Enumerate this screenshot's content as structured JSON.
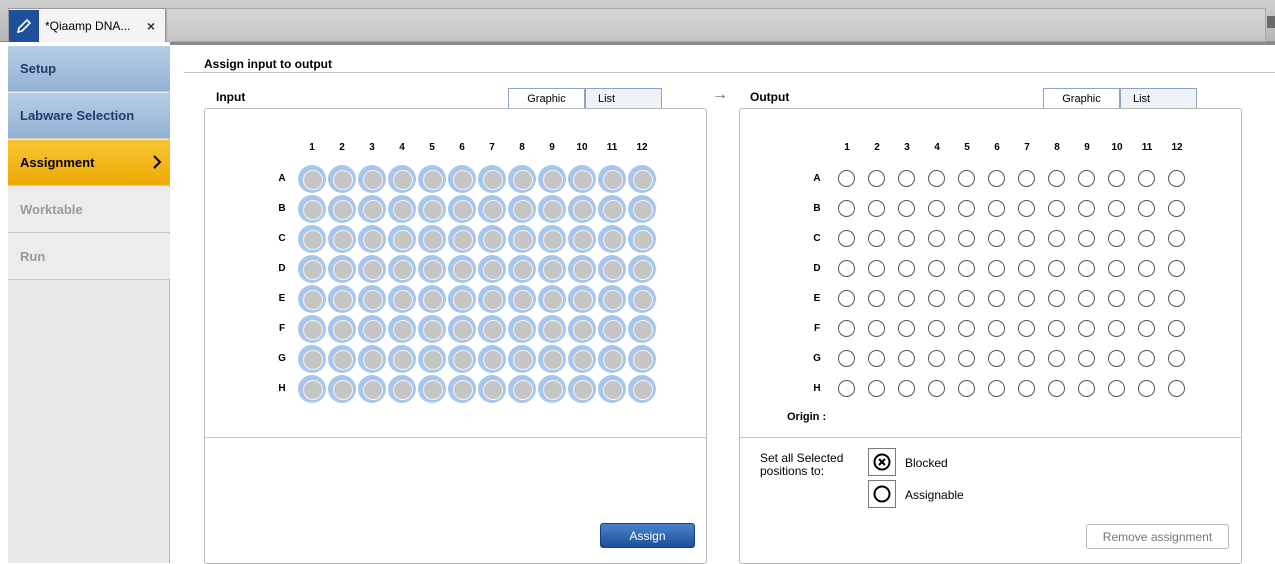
{
  "tab": {
    "title": "*Qiaamp DNA...",
    "close": "×"
  },
  "sidebar": {
    "items": [
      {
        "label": "Setup"
      },
      {
        "label": "Labware Selection"
      },
      {
        "label": "Assignment"
      },
      {
        "label": "Worktable"
      },
      {
        "label": "Run"
      }
    ]
  },
  "main": {
    "title": "Assign input to output",
    "arrow": "→",
    "input": {
      "label": "Input",
      "tabs": [
        "Graphic",
        "List"
      ],
      "assign_button": "Assign"
    },
    "output": {
      "label": "Output",
      "tabs": [
        "Graphic",
        "List"
      ],
      "origin_label": "Origin :",
      "set_selected_label": "Set all Selected positions to:",
      "blocked_label": "Blocked",
      "assignable_label": "Assignable",
      "remove_button": "Remove assignment"
    }
  },
  "plate": {
    "columns": [
      "1",
      "2",
      "3",
      "4",
      "5",
      "6",
      "7",
      "8",
      "9",
      "10",
      "11",
      "12"
    ],
    "rows": [
      "A",
      "B",
      "C",
      "D",
      "E",
      "F",
      "G",
      "H"
    ]
  },
  "colors": {
    "accent": "#eeaa05",
    "nav_blue": "#92b3d4",
    "well_blue": "#a7c6ee",
    "button_blue": "#1d4f9a"
  }
}
